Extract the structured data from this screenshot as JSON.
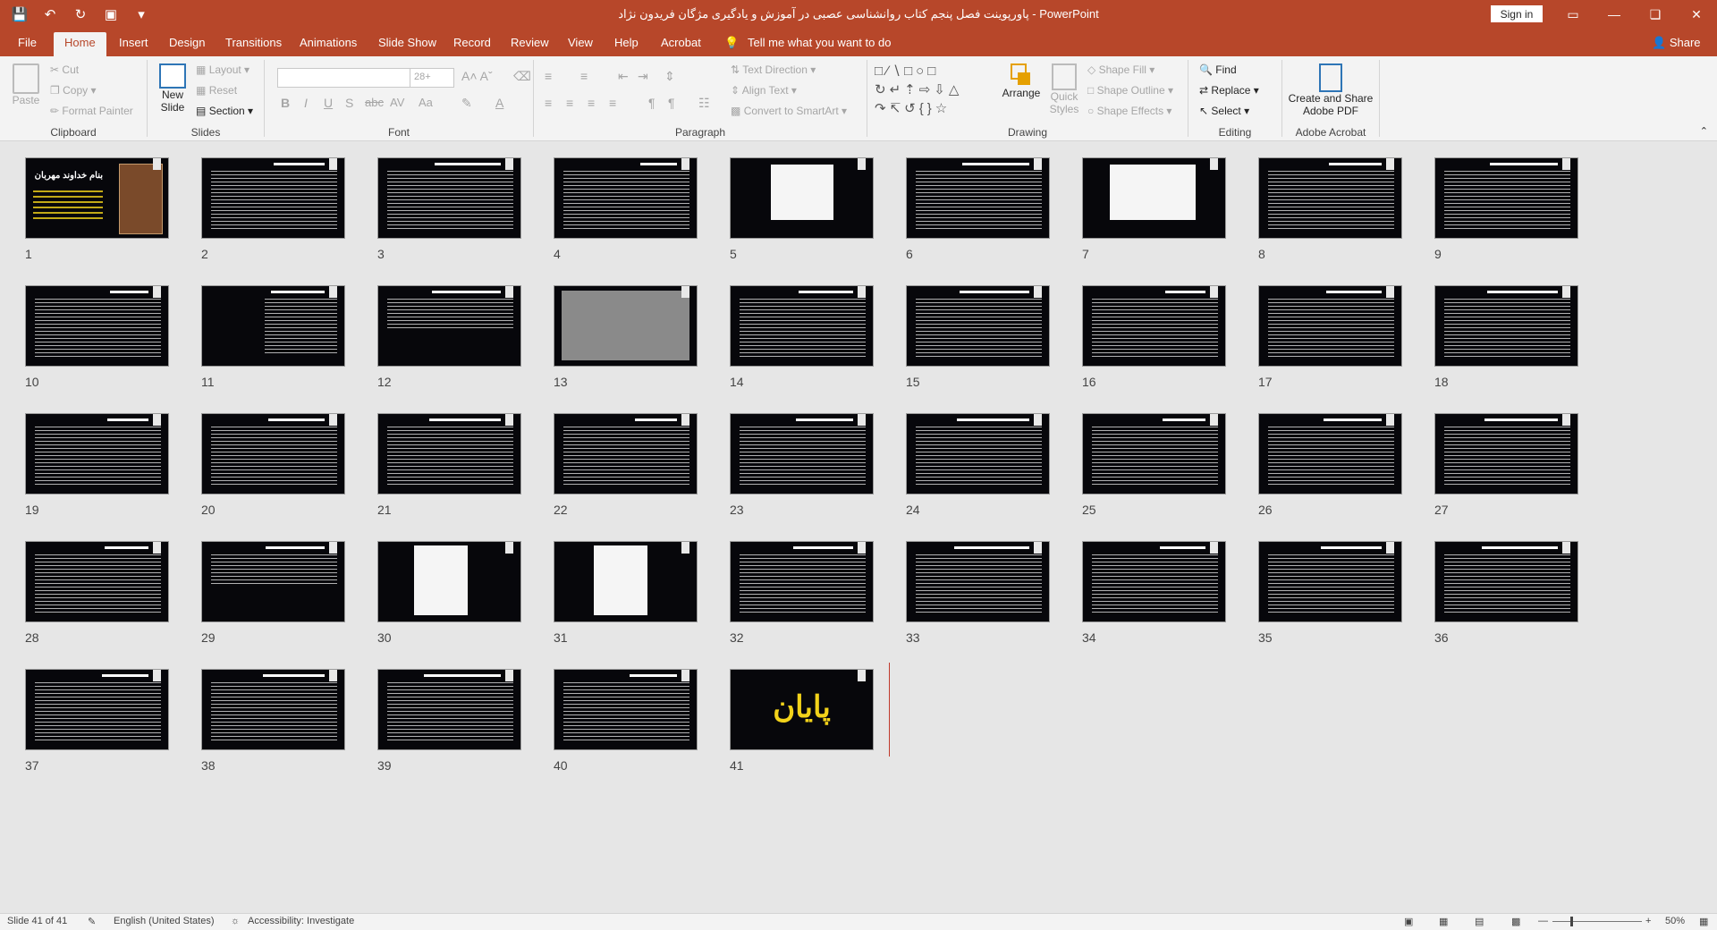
{
  "app": {
    "title": "پاورپوینت فصل پنجم کتاب روانشناسی عصبی در آموزش و یادگیری مژگان فریدون نژاد  -  PowerPoint",
    "sign_in": "Sign in"
  },
  "qat": {
    "save_icon": "save-icon",
    "undo_icon": "undo-icon",
    "redo_icon": "redo-icon",
    "present_icon": "present-icon"
  },
  "menu": {
    "tabs": [
      "File",
      "Home",
      "Insert",
      "Design",
      "Transitions",
      "Animations",
      "Slide Show",
      "Record",
      "Review",
      "View",
      "Help",
      "Acrobat"
    ],
    "tell_me": "Tell me what you want to do",
    "share": "Share"
  },
  "ribbon": {
    "clipboard": {
      "label": "Clipboard",
      "paste": "Paste",
      "cut": "Cut",
      "copy": "Copy",
      "format_painter": "Format Painter"
    },
    "slides": {
      "label": "Slides",
      "new_slide_1": "New",
      "new_slide_2": "Slide",
      "layout": "Layout",
      "reset": "Reset",
      "section": "Section"
    },
    "font": {
      "label": "Font",
      "size": "28+"
    },
    "paragraph": {
      "label": "Paragraph",
      "text_direction": "Text Direction",
      "align_text": "Align Text",
      "convert_smartart": "Convert to SmartArt"
    },
    "drawing": {
      "label": "Drawing",
      "arrange": "Arrange",
      "quick_styles_1": "Quick",
      "quick_styles_2": "Styles",
      "shape_fill": "Shape Fill",
      "shape_outline": "Shape Outline",
      "shape_effects": "Shape Effects"
    },
    "editing": {
      "label": "Editing",
      "find": "Find",
      "replace": "Replace",
      "select": "Select"
    },
    "acrobat": {
      "label": "Adobe Acrobat",
      "create_1": "Create and Share",
      "create_2": "Adobe PDF"
    }
  },
  "slides": [
    {
      "n": "1"
    },
    {
      "n": "2"
    },
    {
      "n": "3"
    },
    {
      "n": "4"
    },
    {
      "n": "5"
    },
    {
      "n": "6"
    },
    {
      "n": "7"
    },
    {
      "n": "8"
    },
    {
      "n": "9"
    },
    {
      "n": "10"
    },
    {
      "n": "11"
    },
    {
      "n": "12"
    },
    {
      "n": "13"
    },
    {
      "n": "14"
    },
    {
      "n": "15"
    },
    {
      "n": "16"
    },
    {
      "n": "17"
    },
    {
      "n": "18"
    },
    {
      "n": "19"
    },
    {
      "n": "20"
    },
    {
      "n": "21"
    },
    {
      "n": "22"
    },
    {
      "n": "23"
    },
    {
      "n": "24"
    },
    {
      "n": "25"
    },
    {
      "n": "26"
    },
    {
      "n": "27"
    },
    {
      "n": "28"
    },
    {
      "n": "29"
    },
    {
      "n": "30"
    },
    {
      "n": "31"
    },
    {
      "n": "32"
    },
    {
      "n": "33"
    },
    {
      "n": "34"
    },
    {
      "n": "35"
    },
    {
      "n": "36"
    },
    {
      "n": "37"
    },
    {
      "n": "38"
    },
    {
      "n": "39"
    },
    {
      "n": "40"
    },
    {
      "n": "41"
    }
  ],
  "slide1_title": "بنام خداوند مهربان",
  "slide41_text": "پایان",
  "status": {
    "slide_of": "Slide 41 of 41",
    "language": "English (United States)",
    "accessibility": "Accessibility: Investigate",
    "zoom": "50%"
  }
}
